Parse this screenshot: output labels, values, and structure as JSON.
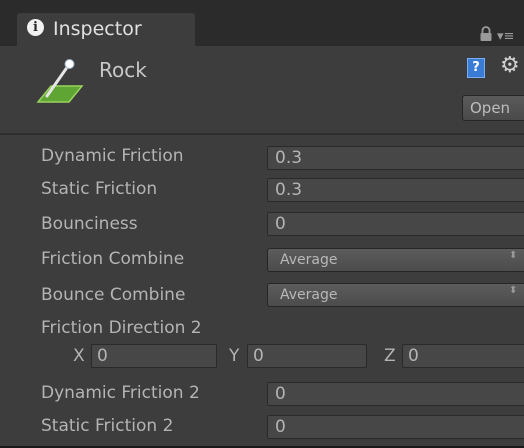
{
  "tab": {
    "title": "Inspector",
    "info_glyph": "i",
    "icons": [
      "info-icon",
      "lock-icon",
      "panel-menu-icon"
    ],
    "menu_glyph": "▾≡"
  },
  "header": {
    "asset_name": "Rock",
    "asset_icon": "physic-material-icon",
    "help_glyph": "?",
    "gear_glyph": "⚙",
    "open_label": "Open"
  },
  "properties": {
    "dynamic_friction": {
      "label": "Dynamic Friction",
      "value": "0.3"
    },
    "static_friction": {
      "label": "Static Friction",
      "value": "0.3"
    },
    "bounciness": {
      "label": "Bounciness",
      "value": "0"
    },
    "friction_combine": {
      "label": "Friction Combine",
      "value": "Average",
      "chevron": "⬍"
    },
    "bounce_combine": {
      "label": "Bounce Combine",
      "value": "Average",
      "chevron": "⬍"
    },
    "friction_direction_2": {
      "label": "Friction Direction 2",
      "x_label": "X",
      "x_value": "0",
      "y_label": "Y",
      "y_value": "0",
      "z_label": "Z",
      "z_value": "0"
    },
    "dynamic_friction_2": {
      "label": "Dynamic Friction 2",
      "value": "0"
    },
    "static_friction_2": {
      "label": "Static Friction 2",
      "value": "0"
    }
  },
  "colors": {
    "panel_bg": "#3d3d3d",
    "tabstrip_bg": "#2b2b2b",
    "field_bg": "#474747",
    "text": "#b4b4b4",
    "help_blue": "#3a7bd5",
    "icon_green": "#7bc142"
  }
}
